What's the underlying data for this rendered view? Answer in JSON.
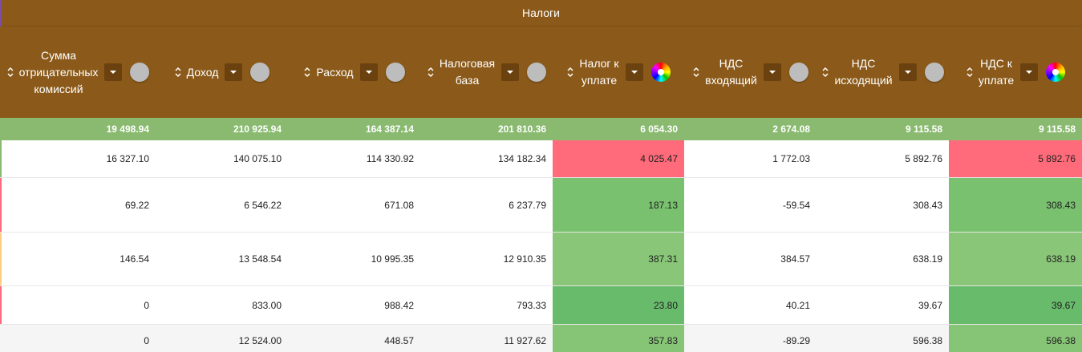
{
  "group_header": "Налоги",
  "columns": [
    {
      "label": "Сумма\nотрицательных\nкомиссий",
      "control": "toggle"
    },
    {
      "label": "Доход",
      "control": "toggle"
    },
    {
      "label": "Расход",
      "control": "toggle"
    },
    {
      "label": "Налоговая\nбаза",
      "control": "toggle"
    },
    {
      "label": "Налог к\nуплате",
      "control": "color-wheel"
    },
    {
      "label": "НДС\nвходящий",
      "control": "toggle"
    },
    {
      "label": "НДС\nисходящий",
      "control": "toggle"
    },
    {
      "label": "НДС к\nуплате",
      "control": "color-wheel"
    }
  ],
  "totals": [
    "19 498.94",
    "210 925.94",
    "164 387.14",
    "201 810.36",
    "6 054.30",
    "2 674.08",
    "9 115.58",
    "9 115.58"
  ],
  "rows": [
    {
      "marker": "#8aba70",
      "bg": "#ffffff",
      "cells": [
        "16 327.10",
        "140 075.10",
        "114 330.92",
        "134 182.34",
        "4 025.47",
        "1 772.03",
        "5 892.76",
        "5 892.76"
      ],
      "highlight": [
        "",
        "",
        "",
        "",
        "#ff6b7a",
        "",
        "",
        "#ff6b7a"
      ]
    },
    {
      "marker": "#ff6b7a",
      "bg": "#ffffff",
      "cells": [
        "69.22",
        "6 546.22",
        "671.08",
        "6 237.79",
        "187.13",
        "-59.54",
        "308.43",
        "308.43"
      ],
      "highlight": [
        "",
        "",
        "",
        "",
        "#79c16f",
        "",
        "",
        "#79c16f"
      ]
    },
    {
      "marker": "#ffcc80",
      "bg": "#ffffff",
      "cells": [
        "146.54",
        "13 548.54",
        "10 995.35",
        "12 910.35",
        "387.31",
        "384.57",
        "638.19",
        "638.19"
      ],
      "highlight": [
        "",
        "",
        "",
        "",
        "#89c677",
        "",
        "",
        "#89c677"
      ]
    },
    {
      "marker": "#ff6b7a",
      "bg": "#ffffff",
      "cells": [
        "0",
        "833.00",
        "988.42",
        "793.33",
        "23.80",
        "40.21",
        "39.67",
        "39.67"
      ],
      "highlight": [
        "",
        "",
        "",
        "",
        "#69bb6c",
        "",
        "",
        "#69bb6c"
      ]
    },
    {
      "marker": "",
      "bg": "#f5f5f5",
      "cells": [
        "0",
        "12 524.00",
        "448.57",
        "11 927.62",
        "357.83",
        "-89.29",
        "596.38",
        "596.38"
      ],
      "highlight": [
        "",
        "",
        "",
        "",
        "#86c576",
        "",
        "",
        "#86c576"
      ]
    }
  ],
  "colors": {
    "header_bg": "#8b5a1a",
    "totals_bg": "#8aba70",
    "negative_highlight": "#ff6b7a",
    "positive_highlight": "#79c16f"
  }
}
